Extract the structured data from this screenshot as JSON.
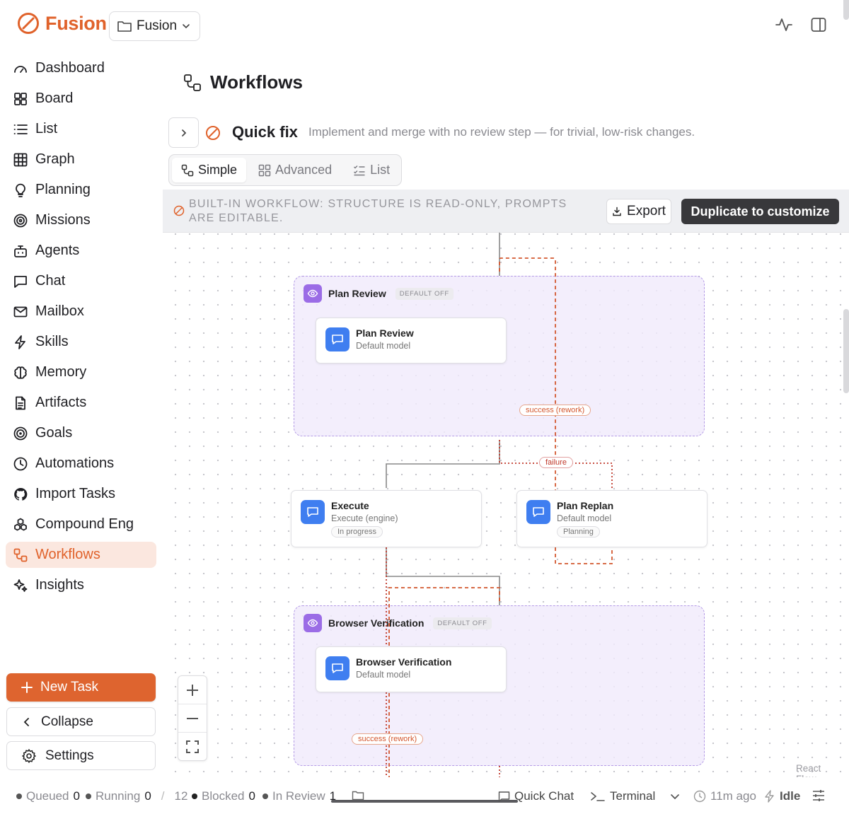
{
  "app": {
    "name": "Fusion",
    "project": "Fusion"
  },
  "nav": [
    {
      "label": "Dashboard",
      "icon": "gauge-icon"
    },
    {
      "label": "Board",
      "icon": "board-icon"
    },
    {
      "label": "List",
      "icon": "list-icon"
    },
    {
      "label": "Graph",
      "icon": "grid-icon"
    },
    {
      "label": "Planning",
      "icon": "lightbulb-icon"
    },
    {
      "label": "Missions",
      "icon": "target-icon"
    },
    {
      "label": "Agents",
      "icon": "bot-icon"
    },
    {
      "label": "Chat",
      "icon": "chat-icon"
    },
    {
      "label": "Mailbox",
      "icon": "mail-icon"
    },
    {
      "label": "Skills",
      "icon": "bolt-icon"
    },
    {
      "label": "Memory",
      "icon": "brain-icon"
    },
    {
      "label": "Artifacts",
      "icon": "file-icon"
    },
    {
      "label": "Goals",
      "icon": "goal-icon"
    },
    {
      "label": "Automations",
      "icon": "clock-icon"
    },
    {
      "label": "Import Tasks",
      "icon": "github-icon"
    },
    {
      "label": "Compound Eng",
      "icon": "boxes-icon"
    },
    {
      "label": "Workflows",
      "icon": "workflow-icon",
      "active": true
    },
    {
      "label": "Insights",
      "icon": "sparkles-icon"
    }
  ],
  "sidebar_actions": {
    "new_task": "New Task",
    "collapse": "Collapse",
    "settings": "Settings"
  },
  "page": {
    "title": "Workflows"
  },
  "workflow": {
    "name": "Quick fix",
    "description": "Implement and merge with no review step — for trivial, low-risk changes."
  },
  "view_modes": [
    {
      "label": "Simple",
      "active": true
    },
    {
      "label": "Advanced",
      "active": false
    },
    {
      "label": "List",
      "active": false
    }
  ],
  "banner": {
    "text": "BUILT-IN WORKFLOW: STRUCTURE IS READ-ONLY, PROMPTS ARE EDITABLE.",
    "export": "Export",
    "duplicate": "Duplicate to customize"
  },
  "graph": {
    "groups": {
      "plan_review": {
        "title": "Plan Review",
        "badge": "DEFAULT OFF"
      },
      "browser_verification": {
        "title": "Browser Verification",
        "badge": "DEFAULT OFF"
      }
    },
    "nodes": {
      "plan_review": {
        "title": "Plan Review",
        "subtitle": "Default model"
      },
      "execute": {
        "title": "Execute",
        "subtitle": "Execute (engine)",
        "status": "In progress"
      },
      "plan_replan": {
        "title": "Plan Replan",
        "subtitle": "Default model",
        "status": "Planning"
      },
      "browser_verification": {
        "title": "Browser Verification",
        "subtitle": "Default model"
      }
    },
    "edge_labels": {
      "success_rework_1": "success (rework)",
      "failure": "failure",
      "success_rework_2": "success (rework)"
    },
    "attribution": "React Flow"
  },
  "status_bar": {
    "queued_label": "Queued",
    "queued": "0",
    "running_label": "Running",
    "running": "0",
    "slash": "/",
    "total": "12",
    "blocked_label": "Blocked",
    "blocked": "0",
    "in_review_label": "In Review",
    "in_review": "1",
    "quick_chat": "Quick Chat",
    "terminal": "Terminal",
    "last_update": "11m ago",
    "engine_state": "Idle"
  },
  "colors": {
    "accent": "#e0622b",
    "node_icon": "#3f7ef0",
    "group_icon": "#9b6ce6",
    "dashed_edge": "#d3572f"
  }
}
